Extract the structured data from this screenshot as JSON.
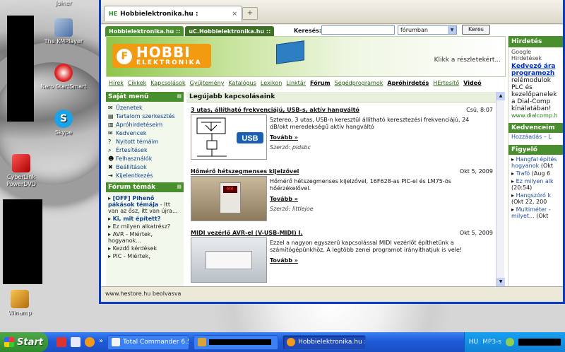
{
  "desktop": {
    "icons": [
      {
        "label": "Joiner"
      },
      {
        "label": "The KMPlayer"
      },
      {
        "label": "Nero StartSmart"
      },
      {
        "label": "Skype"
      },
      {
        "label": "CyberLink PowerDVD"
      },
      {
        "label": "Winamp"
      }
    ]
  },
  "browser": {
    "tab_favicon": "HE",
    "tab_title": "Hobbielektronika.hu :",
    "tab_close": "×",
    "new_tab": "+",
    "status": "www.hestore.hu beolvasva"
  },
  "site": {
    "tabs": [
      "Hobbielektronika.hu ::",
      "uC.Hobbielektronika.hu ::"
    ],
    "search_label": "Keresés:",
    "search_value": "",
    "search_scope": "fórumban",
    "search_button": "Keres",
    "banner": {
      "logo_main": "HOBBI",
      "logo_sub": "ELEKTRONIKA",
      "click_text": "Klikk a részletekért..."
    },
    "nav": [
      "Hírek",
      "Cikkek",
      "Kapcsolások",
      "Gyűjtemény",
      "Katalógus",
      "Lexikon",
      "Linktár",
      "Fórum",
      "Segédprogramok",
      "Apróhirdetés",
      "HErtesítő",
      "Videó"
    ],
    "menu_title": "Saját menü",
    "menu": [
      "Üzenetek",
      "Tartalom szerkesztés",
      "Apróhirdetéseim",
      "Kedvencek",
      "Nyitott témáim",
      "Értesítések",
      "Felhasználók",
      "Beállítások",
      "Kijelentkezés"
    ],
    "forum_title": "Fórum témák",
    "forum": [
      {
        "title": "[OFF] Pihenő pákások témája",
        "text": "- Itt van az ősz, itt van újra..."
      },
      {
        "title": "Ki, mit épített?",
        "text": ""
      },
      {
        "title": "",
        "text": "Ez milyen alkatrész?"
      },
      {
        "title": "",
        "text": "AVR - Miértek, hogyanok..."
      },
      {
        "title": "",
        "text": "Kezdő kérdések"
      },
      {
        "title": "",
        "text": "PIC - Miértek,"
      }
    ],
    "main_title": "Legújabb kapcsolásaink",
    "articles": [
      {
        "title": "3 utas, állítható frekvenciájú, USB-s, aktív hangváltó",
        "date": "Csü, 8:07",
        "desc": "Sztereo, 3 utas, USB-n keresztül állítható keresztezési frekvenciájú, 24 dB/okt meredekségű aktív hangváltó",
        "more": "Tovább »",
        "author": "Szerző: pidsbc"
      },
      {
        "title": "Hőmérő hétszegmenses kijelzővel",
        "date": "Okt 5, 2009",
        "desc": "Hőmérő hétszegmenses kijelzővel, 16F628-as PIC-el és LM75-ös hőérzékelővel.",
        "more": "Tovább »",
        "author": "Szerző: littlejoe"
      },
      {
        "title": "MIDI vezérlő AVR-el (V-USB-MIDI) I.",
        "date": "Okt 5, 2009",
        "desc": "Ezzel a nagyon egyszerű kapcsolással MIDI vezérlőt építhetünk a számítógépünkhöz. A legtöbb zenei programot irányíthatjuk is vele!",
        "more": "Tovább »",
        "author": ""
      }
    ],
    "right": {
      "header": "Hirdetés",
      "google": "Google Hirdetések",
      "ad_title": "Kedvező ára programozh",
      "ad_text": "relémodulok PLC és kezelőpanelek a Dial-Comp kínálatában!",
      "ad_url": "www.dialcomp.h",
      "fav_header": "Kedvenceim",
      "fav_line": "Hozzáadás – L",
      "watch_header": "Figyelő",
      "watch": [
        {
          "t": "Hangfal építés hogyanok",
          "d": "(Okt"
        },
        {
          "t": "Trafó",
          "d": "(Aug 6"
        },
        {
          "t": "Ez milyen alk",
          "d": "(20:54)"
        },
        {
          "t": "Hangszóró k",
          "d": "(Okt 22, 200"
        },
        {
          "t": "Multiméter - milyet...",
          "d": "(Okt"
        }
      ]
    }
  },
  "taskbar": {
    "start": "Start",
    "buttons": [
      "Total Commander 6.5...",
      "",
      "Hobbielektronika.hu :..."
    ],
    "lang": "HU",
    "tray_text": "MP3-s"
  }
}
